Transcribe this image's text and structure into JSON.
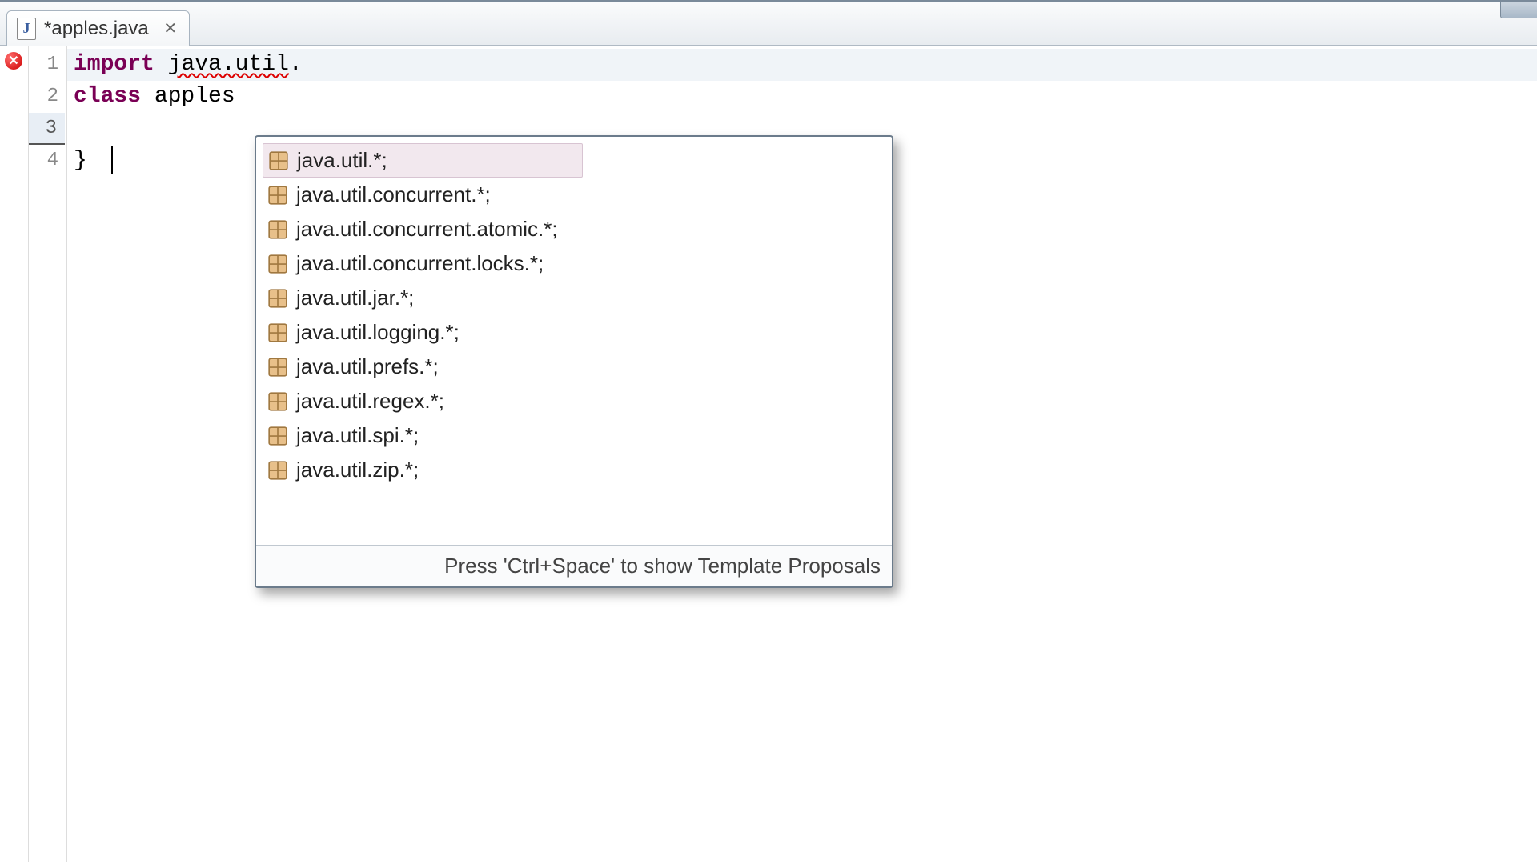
{
  "tab": {
    "icon_letter": "J",
    "filename": "*apples.java",
    "close_glyph": "✕"
  },
  "error_marker_glyph": "✕",
  "line_numbers": [
    "1",
    "2",
    "3",
    "4"
  ],
  "code": {
    "line1_kw": "import",
    "line1_pkg": "java.util",
    "line1_dot": ".",
    "line2_kw": "class",
    "line2_name": " apples",
    "line4_brace": "}"
  },
  "autocomplete": {
    "suggestions": [
      "java.util.*;",
      "java.util.concurrent.*;",
      "java.util.concurrent.atomic.*;",
      "java.util.concurrent.locks.*;",
      "java.util.jar.*;",
      "java.util.logging.*;",
      "java.util.prefs.*;",
      "java.util.regex.*;",
      "java.util.spi.*;",
      "java.util.zip.*;"
    ],
    "selected_index": 0,
    "footer": "Press 'Ctrl+Space' to show Template Proposals"
  }
}
